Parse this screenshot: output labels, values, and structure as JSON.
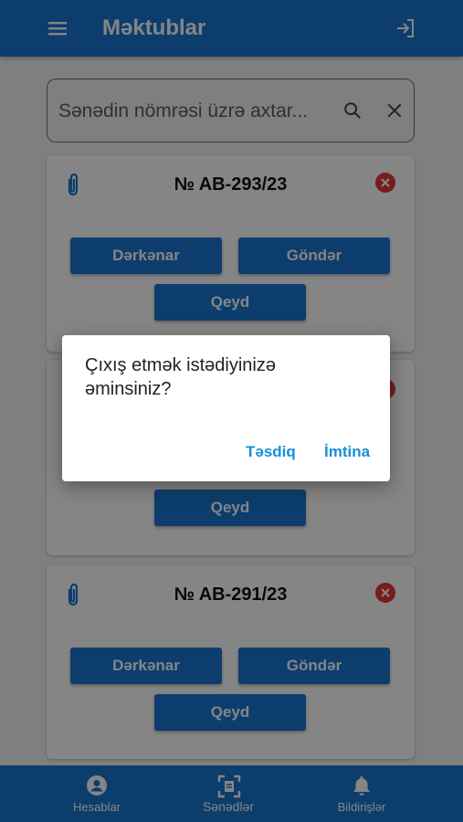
{
  "appbar": {
    "title": "Məktublar",
    "menu_icon": "hamburger-menu-icon",
    "logout_icon": "logout-icon"
  },
  "search": {
    "placeholder": "Sənədin nömrəsi üzrə axtar...",
    "search_icon": "search-icon",
    "clear_icon": "close-icon"
  },
  "documents": [
    {
      "number": "№ AB-293/23",
      "buttons": [
        "Dərkənar",
        "Göndər",
        "Qeyd"
      ]
    },
    {
      "number": "",
      "buttons": [
        "Qeyd"
      ]
    },
    {
      "number": "№ AB-291/23",
      "buttons": [
        "Dərkənar",
        "Göndər",
        "Qeyd"
      ]
    }
  ],
  "bottom_nav": [
    {
      "label": "Hesablar",
      "icon": "account-circle-icon"
    },
    {
      "label": "Sənədlər",
      "icon": "document-scan-icon"
    },
    {
      "label": "Bildirişlər",
      "icon": "bell-icon"
    }
  ],
  "dialog": {
    "message": "Çıxış etmək istədiyinizə əminsiniz?",
    "confirm_label": "Təsdiq",
    "cancel_label": "İmtina"
  },
  "colors": {
    "primary": "#1976d2",
    "accent_text": "#1a8fd8",
    "delete_red": "#e53935"
  }
}
